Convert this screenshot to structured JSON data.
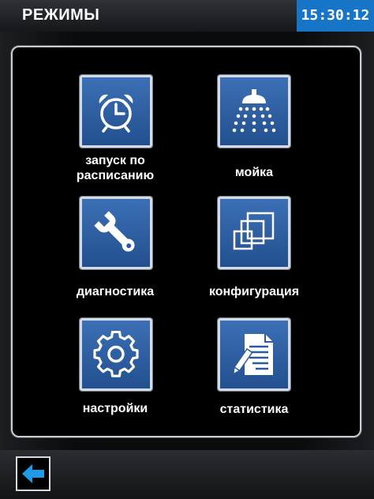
{
  "header": {
    "title": "РЕЖИМЫ",
    "clock": "15:30:12"
  },
  "menu": {
    "schedule_label": "запуск по\nрасписанию",
    "wash_label": "мойка",
    "diagnostics_label": "диагностика",
    "configuration_label": "конфигурация",
    "settings_label": "настройки",
    "statistics_label": "статистика"
  },
  "icons": {
    "schedule": "alarm-clock-icon",
    "wash": "shower-head-icon",
    "diagnostics": "wrench-icon",
    "configuration": "stacked-windows-icon",
    "settings": "gear-icon",
    "statistics": "document-pencil-icon",
    "back": "back-arrow-icon"
  },
  "colors": {
    "accent": "#1775c7",
    "tile": "#2f5fa3",
    "back_arrow": "#1e9be8"
  }
}
